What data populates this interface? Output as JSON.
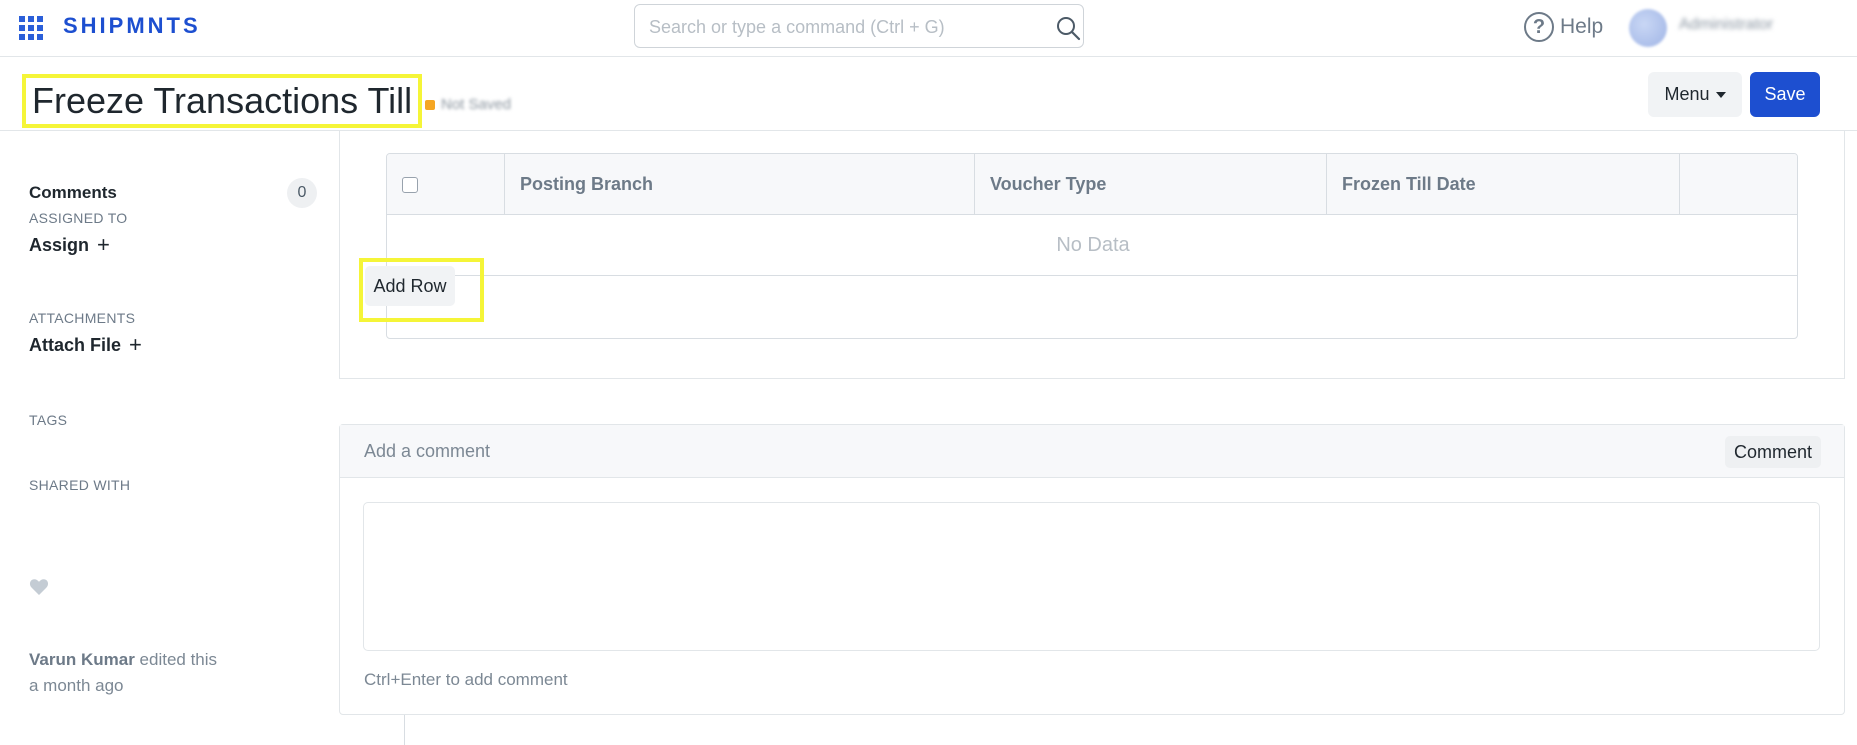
{
  "navbar": {
    "brand": "SHIPMNTS",
    "search_placeholder": "Search or type a command (Ctrl + G)",
    "help_label": "Help",
    "user_name": "Administrator"
  },
  "page": {
    "title": "Freeze Transactions Till",
    "status": "Not Saved",
    "menu_label": "Menu",
    "save_label": "Save"
  },
  "sidebar": {
    "comments_label": "Comments",
    "comments_count": "0",
    "assigned_to_label": "ASSIGNED TO",
    "assign_label": "Assign",
    "attachments_label": "ATTACHMENTS",
    "attach_file_label": "Attach File",
    "tags_label": "TAGS",
    "shared_with_label": "SHARED WITH",
    "activity_user": "Varun Kumar",
    "activity_action": "edited this",
    "activity_time": "a month ago"
  },
  "grid": {
    "columns": [
      "Posting Branch",
      "Voucher Type",
      "Frozen Till Date"
    ],
    "empty_text": "No Data",
    "add_row_label": "Add Row"
  },
  "comment": {
    "placeholder": "Add a comment",
    "button_label": "Comment",
    "hint": "Ctrl+Enter to add comment"
  },
  "colors": {
    "brand": "#1d4fd0",
    "highlight": "#f5f538",
    "status_indicator": "#f5a623"
  }
}
